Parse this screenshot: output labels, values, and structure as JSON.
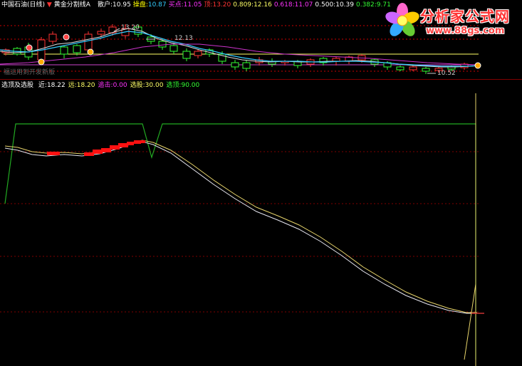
{
  "header": {
    "stock_name": "中国石油(日线)",
    "indicator_name": "黄金分割线A",
    "fields": [
      {
        "label": "散户:",
        "value": "10.95",
        "label_color": "#ffffff",
        "value_color": "#ffffff"
      },
      {
        "label": "操盘:",
        "value": "10.87",
        "label_color": "#ffff00",
        "value_color": "#33ccff"
      },
      {
        "label": "买点:",
        "value": "11.05",
        "label_color": "#ff33ff",
        "value_color": "#ff33ff"
      },
      {
        "label": "顶:",
        "value": "13.20",
        "label_color": "#ff3333",
        "value_color": "#ff3333"
      },
      {
        "label": "0.809:",
        "value": "12.16",
        "label_color": "#ffff66",
        "value_color": "#ffff66"
      },
      {
        "label": "0.618:",
        "value": "11.07",
        "label_color": "#ff33ff",
        "value_color": "#ff33ff"
      },
      {
        "label": "0.500:",
        "value": "10.39",
        "label_color": "#ffffff",
        "value_color": "#ffffff"
      },
      {
        "label": "0.382:",
        "value": "9.71",
        "label_color": "#33ff33",
        "value_color": "#33ff33"
      }
    ]
  },
  "main_annotations": {
    "high_label": "13.20",
    "mid_label": "12.13",
    "low_label": "10.52",
    "watermark": "福运用到开发新版"
  },
  "sub_header": {
    "title": "选顶及选股",
    "fields": [
      {
        "label": "近:",
        "value": "18.22",
        "color": "#ffffff"
      },
      {
        "label": "远:",
        "value": "18.20",
        "color": "#ffff66"
      },
      {
        "label": "追击:",
        "value": "0.00",
        "color": "#ff33ff"
      },
      {
        "label": "选股:",
        "value": "30.00",
        "color": "#ffff66"
      },
      {
        "label": "选顶:",
        "value": "90.00",
        "color": "#33ff33"
      }
    ]
  },
  "logo": {
    "title": "分析家公式网",
    "url": "www.88gs.com"
  }
}
